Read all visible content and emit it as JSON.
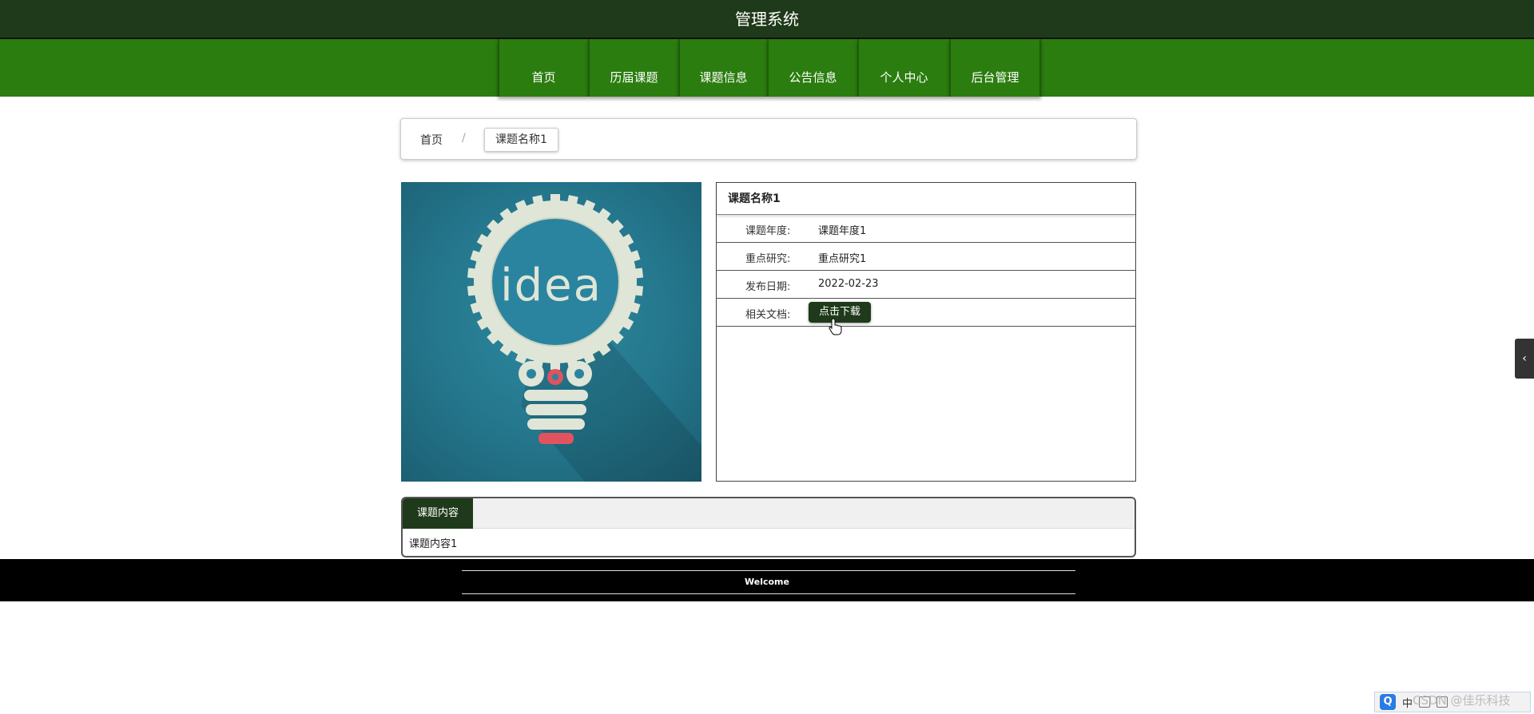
{
  "header": {
    "title": "管理系统"
  },
  "nav": {
    "items": [
      {
        "label": "首页"
      },
      {
        "label": "历届课题"
      },
      {
        "label": "课题信息"
      },
      {
        "label": "公告信息"
      },
      {
        "label": "个人中心"
      },
      {
        "label": "后台管理"
      }
    ]
  },
  "breadcrumb": {
    "home": "首页",
    "separator": "/",
    "current": "课题名称1"
  },
  "image": {
    "text": "idea"
  },
  "detail": {
    "title": "课题名称1",
    "rows": [
      {
        "label": "课题年度:",
        "value": "课题年度1"
      },
      {
        "label": "重点研究:",
        "value": "重点研究1"
      },
      {
        "label": "发布日期:",
        "value": "2022-02-23"
      },
      {
        "label": "相关文档:",
        "button": "点击下载"
      }
    ]
  },
  "content": {
    "tab": "课题内容",
    "body": "课题内容1"
  },
  "footer": {
    "text": "Welcome"
  },
  "side_toggle": {
    "icon": "chevron-left-icon",
    "glyph": "‹"
  },
  "taskbar": {
    "ime_logo": "Q",
    "ime_mode": "中",
    "watermark": "CSDN @佳乐科技"
  },
  "colors": {
    "header": "#1f3a1a",
    "nav": "#2b7d0f",
    "button": "#1f3a1a",
    "footer": "#000000"
  }
}
